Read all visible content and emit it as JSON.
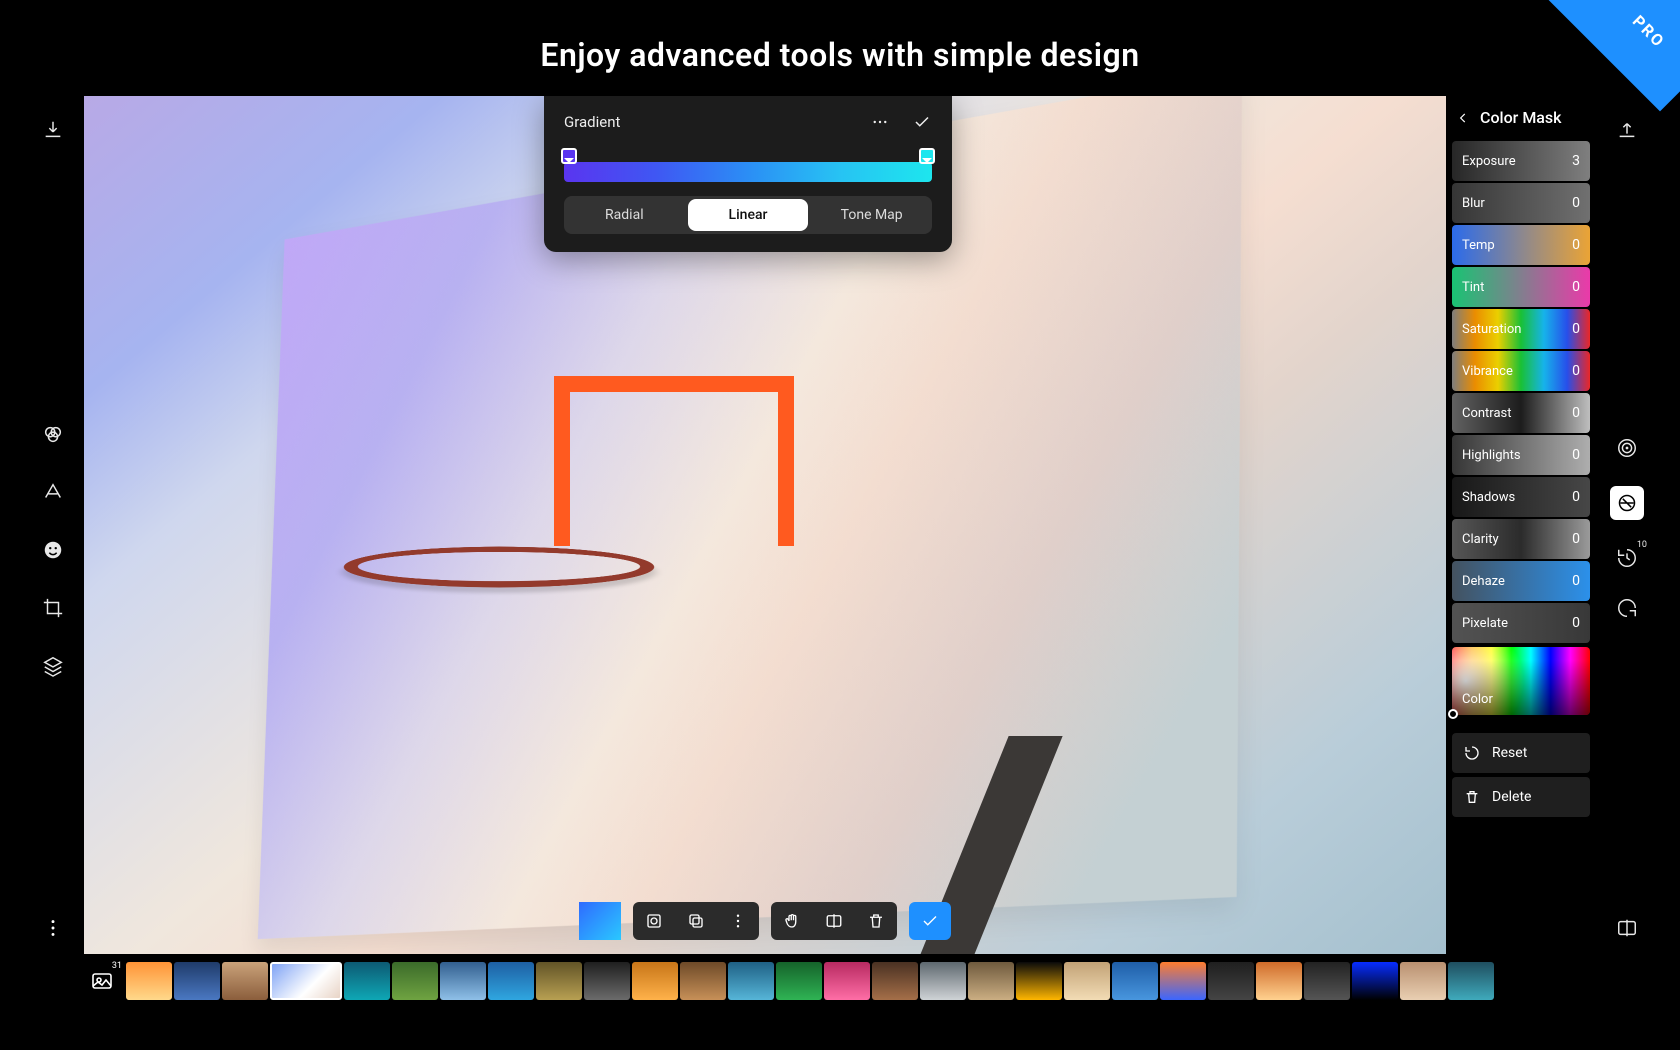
{
  "headline": "Enjoy advanced tools with simple design",
  "pro_badge": "PRO",
  "gradient_panel": {
    "title": "Gradient",
    "segs": {
      "radial": "Radial",
      "linear": "Linear",
      "tonemap": "Tone Map"
    },
    "active": "Linear"
  },
  "sidebar": {
    "title": "Color Mask",
    "sliders": [
      {
        "label": "Exposure",
        "value": "3",
        "bg": "linear-gradient(90deg,#2a2a2a,#8a8a8a)"
      },
      {
        "label": "Blur",
        "value": "0",
        "bg": "linear-gradient(90deg,#3a3a3a,#7a7a7a)"
      },
      {
        "label": "Temp",
        "value": "0",
        "bg": "linear-gradient(90deg,#2f74ff,#ffb23a)"
      },
      {
        "label": "Tint",
        "value": "0",
        "bg": "linear-gradient(90deg,#1bd47d,#ff3fb8)"
      },
      {
        "label": "Saturation",
        "value": "0",
        "bg": "linear-gradient(90deg,#888,#ff9900,#ffe100,#1bd13a,#18c2ff,#2a56ff,#ff2a2a)"
      },
      {
        "label": "Vibrance",
        "value": "0",
        "bg": "linear-gradient(90deg,#888,#ff9900,#ffe100,#1bd13a,#18c2ff,#2a56ff,#ff2a2a)"
      },
      {
        "label": "Contrast",
        "value": "0",
        "bg": "linear-gradient(90deg,#6a6a6a,#1f1f1f,#cfcfcf)"
      },
      {
        "label": "Highlights",
        "value": "0",
        "bg": "linear-gradient(90deg,#3a3a3a,#bdbdbd)"
      },
      {
        "label": "Shadows",
        "value": "0",
        "bg": "linear-gradient(90deg,#1a1a1a,#4d4d4d)"
      },
      {
        "label": "Clarity",
        "value": "0",
        "bg": "linear-gradient(90deg,#5e5e5e,#2f2f2f,#a8a8a8)"
      },
      {
        "label": "Dehaze",
        "value": "0",
        "bg": "linear-gradient(90deg,#4a5968,#2f9dff)"
      },
      {
        "label": "Pixelate",
        "value": "0",
        "bg": "linear-gradient(90deg,#5a5a5a,#3d3d3d)"
      }
    ],
    "color_label": "Color",
    "reset": "Reset",
    "delete": "Delete"
  },
  "filmstrip": {
    "count": "31",
    "thumbs": [
      "linear-gradient(180deg,#ff9336,#ffd98b)",
      "linear-gradient(180deg,#1f3b6a,#4a78c2)",
      "linear-gradient(180deg,#caa27a,#8b5e3c)",
      "selected",
      "linear-gradient(180deg,#0d5a73,#0ea7b5)",
      "linear-gradient(180deg,#3b6b2a,#6fa341)",
      "linear-gradient(180deg,#325f8f,#8fc0e8)",
      "linear-gradient(180deg,#1e5fa3,#2fa6e0)",
      "linear-gradient(180deg,#625427,#b8a052)",
      "linear-gradient(180deg,#1f1f1f,#6b6b6b)",
      "linear-gradient(180deg,#c77518,#ffb24a)",
      "linear-gradient(180deg,#6e4a28,#c79058)",
      "linear-gradient(180deg,#1f6185,#56b5d8)",
      "linear-gradient(180deg,#15632a,#2fb354)",
      "linear-gradient(180deg,#b72a61,#ff6ea6)",
      "linear-gradient(180deg,#4a3122,#a56f48)",
      "linear-gradient(180deg,#5e686f,#cfd3d6)",
      "linear-gradient(180deg,#6f5a3e,#cbae82)",
      "linear-gradient(180deg,#0a0a0a,#ffb600)",
      "linear-gradient(180deg,#c2a276,#f2dcb5)",
      "linear-gradient(180deg,#1f5ea8,#4896de)",
      "linear-gradient(180deg,#ff7d2e,#3b66ff)",
      "linear-gradient(180deg,#1f1f1f,#444)",
      "linear-gradient(180deg,#cf6b2a,#ffd18f)",
      "linear-gradient(180deg,#222,#555)",
      "linear-gradient(180deg,#072dff,#000)",
      "linear-gradient(180deg,#b99070,#e9cfb2)",
      "linear-gradient(180deg,#1f4e5f,#3faabc)"
    ]
  }
}
